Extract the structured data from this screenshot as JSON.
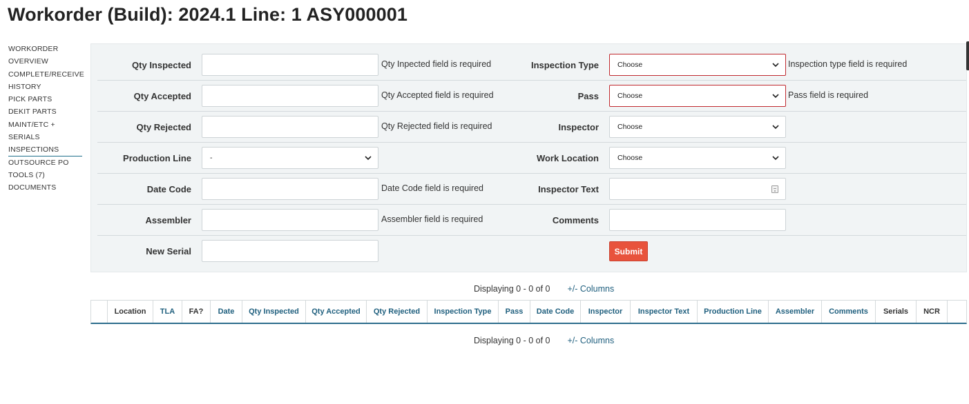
{
  "page": {
    "title": "Workorder (Build): 2024.1 Line: 1 ASY000001"
  },
  "sidebar": {
    "items": [
      {
        "label": "WORKORDER"
      },
      {
        "label": "OVERVIEW"
      },
      {
        "label": "COMPLETE/RECEIVE"
      },
      {
        "label": "HISTORY"
      },
      {
        "label": "PICK PARTS"
      },
      {
        "label": "DEKIT PARTS"
      },
      {
        "label": "MAINT/ETC +"
      },
      {
        "label": "SERIALS"
      },
      {
        "label": "INSPECTIONS",
        "active": true
      },
      {
        "label": "OUTSOURCE PO"
      },
      {
        "label": "TOOLS (7)"
      },
      {
        "label": "DOCUMENTS"
      }
    ]
  },
  "form": {
    "left": [
      {
        "label": "Qty Inspected",
        "type": "text",
        "value": "",
        "hint": "Qty Inpected field is required"
      },
      {
        "label": "Qty Accepted",
        "type": "text",
        "value": "",
        "hint": "Qty Accepted field is required"
      },
      {
        "label": "Qty Rejected",
        "type": "text",
        "value": "",
        "hint": "Qty Rejected field is required"
      },
      {
        "label": "Production Line",
        "type": "select",
        "value": "-",
        "hint": ""
      },
      {
        "label": "Date Code",
        "type": "text",
        "value": "",
        "hint": "Date Code field is required"
      },
      {
        "label": "Assembler",
        "type": "text",
        "value": "",
        "hint": "Assembler field is required"
      },
      {
        "label": "New Serial",
        "type": "text",
        "value": "",
        "hint": ""
      }
    ],
    "right": [
      {
        "label": "Inspection Type",
        "type": "select",
        "value": "Choose",
        "error": true,
        "hint": "Inspection type field is required"
      },
      {
        "label": "Pass",
        "type": "select",
        "value": "Choose",
        "error": true,
        "hint": "Pass field is required"
      },
      {
        "label": "Inspector",
        "type": "select",
        "value": "Choose",
        "hint": ""
      },
      {
        "label": "Work Location",
        "type": "select",
        "value": "Choose",
        "hint": ""
      },
      {
        "label": "Inspector Text",
        "type": "text-icon",
        "value": "",
        "hint": ""
      },
      {
        "label": "Comments",
        "type": "text",
        "value": "",
        "hint": ""
      }
    ],
    "submit_label": "Submit"
  },
  "pager": {
    "display_text": "Displaying 0 - 0 of 0",
    "columns_link": "+/- Columns"
  },
  "table": {
    "columns": [
      {
        "label": "Location",
        "link": false
      },
      {
        "label": "TLA",
        "link": true
      },
      {
        "label": "FA?",
        "link": false
      },
      {
        "label": "Date",
        "link": true
      },
      {
        "label": "Qty Inspected",
        "link": true
      },
      {
        "label": "Qty Accepted",
        "link": true
      },
      {
        "label": "Qty Rejected",
        "link": true
      },
      {
        "label": "Inspection Type",
        "link": true
      },
      {
        "label": "Pass",
        "link": true
      },
      {
        "label": "Date Code",
        "link": true
      },
      {
        "label": "Inspector",
        "link": true
      },
      {
        "label": "Inspector Text",
        "link": true
      },
      {
        "label": "Production Line",
        "link": true
      },
      {
        "label": "Assembler",
        "link": true
      },
      {
        "label": "Comments",
        "link": true
      },
      {
        "label": "Serials",
        "link": false
      },
      {
        "label": "NCR",
        "link": false
      }
    ]
  },
  "colors": {
    "accent": "#1f5f7e",
    "error_border": "#c0282e",
    "submit_bg": "#e8533c",
    "panel_bg": "#f1f4f5"
  }
}
